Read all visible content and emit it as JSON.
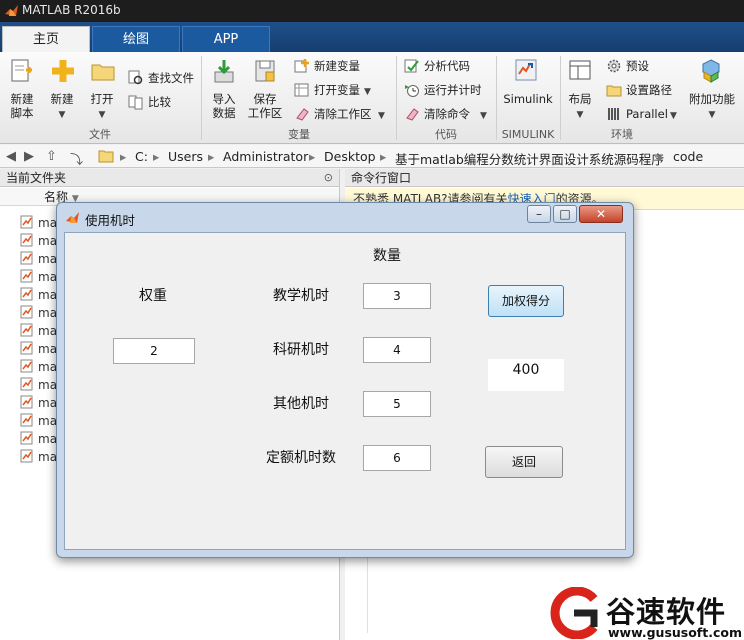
{
  "window": {
    "title": "MATLAB R2016b"
  },
  "tabs": [
    {
      "label": "主页"
    },
    {
      "label": "绘图"
    },
    {
      "label": "APP"
    }
  ],
  "ribbon": {
    "file": {
      "new_script": [
        "新建",
        "脚本"
      ],
      "new": "新建",
      "open": "打开",
      "find_files": "查找文件",
      "compare": "比较",
      "section": "文件"
    },
    "variable": {
      "import": [
        "导入",
        "数据"
      ],
      "save": [
        "保存",
        "工作区"
      ],
      "new_var": "新建变量",
      "open_var": "打开变量",
      "clear_ws": "清除工作区",
      "section": "变量"
    },
    "code": {
      "analyze": "分析代码",
      "run_time": "运行并计时",
      "clear_cmd": "清除命令",
      "section": "代码"
    },
    "simulink": {
      "label": "Simulink",
      "section": "SIMULINK"
    },
    "env": {
      "layout": "布局",
      "prefs": "预设",
      "set_path": "设置路径",
      "parallel": "Parallel",
      "section": "环境"
    },
    "addons": [
      "附加功能"
    ]
  },
  "address": {
    "crumbs": [
      "C:",
      "Users",
      "Administrator",
      "Desktop",
      "基于matlab编程分数统计界面设计系统源码程序",
      "code"
    ]
  },
  "left_panel": {
    "title": "当前文件夹",
    "name_header": "名称",
    "files": [
      "ma",
      "ma",
      "ma",
      "ma",
      "ma",
      "ma",
      "ma",
      "ma",
      "ma",
      "ma",
      "ma",
      "ma",
      "ma",
      "ma"
    ]
  },
  "command_window": {
    "title": "命令行窗口",
    "tip_prefix": "不熟悉 MATLAB?请参阅有关",
    "tip_link": "快速入门",
    "tip_suffix": "的资源。"
  },
  "dialog": {
    "title": "使用机时",
    "quantity_header": "数量",
    "weight_label": "权重",
    "weight_value": "2",
    "rows": [
      {
        "label": "教学机时",
        "value": "3"
      },
      {
        "label": "科研机时",
        "value": "4"
      },
      {
        "label": "其他机时",
        "value": "5"
      },
      {
        "label": "定额机时数",
        "value": "6"
      }
    ],
    "score_button": "加权得分",
    "result": "400",
    "back_button": "返回"
  },
  "watermark": {
    "name": "谷速软件",
    "url": "www.gususoft.com"
  },
  "colors": {
    "matlab_blue": "#1c5aa0",
    "accent_red": "#d8241b"
  }
}
